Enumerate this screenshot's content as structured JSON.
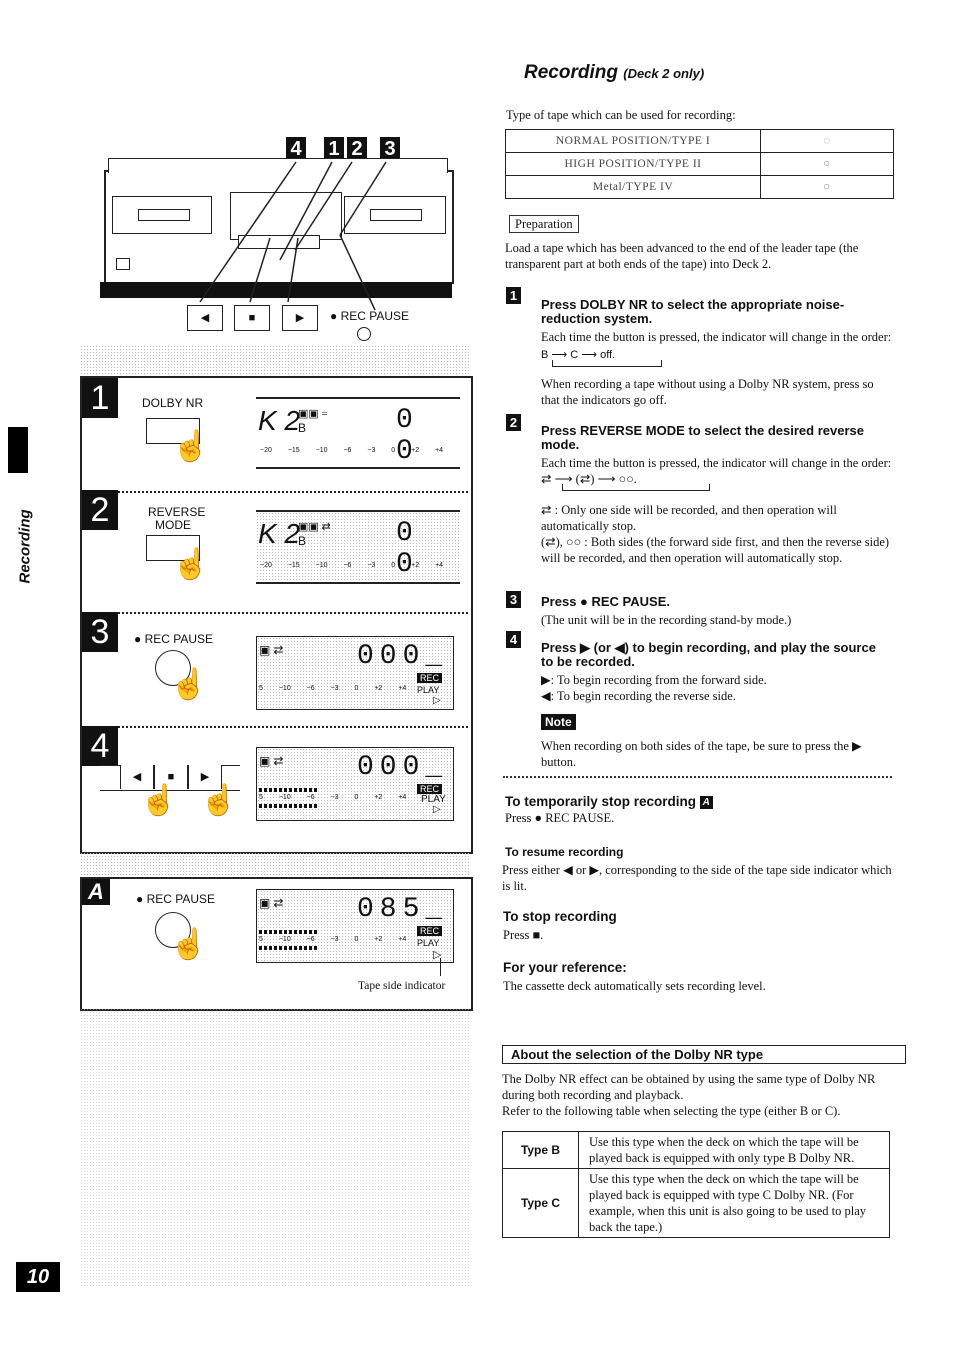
{
  "side_tab": {
    "label": "Recording"
  },
  "page_number": "10",
  "header": {
    "title": "Recording",
    "subtitle": "(Deck 2 only)"
  },
  "tape_types": {
    "intro": "Type of tape which can be used for recording:",
    "rows": [
      {
        "type": "NORMAL POSITION/TYPE I",
        "indicator": "circle-dim"
      },
      {
        "type": "HIGH POSITION/TYPE II",
        "indicator": "circle"
      },
      {
        "type": "Metal/TYPE IV",
        "indicator": "circle"
      }
    ]
  },
  "preparation": {
    "label": "Preparation",
    "text": "Load a tape which has been advanced to the end of the leader tape (the transparent part at both ends of the tape) into Deck 2."
  },
  "steps": [
    {
      "number": "1",
      "heading": "Press DOLBY NR to select the appropriate noise-reduction system.",
      "text": "Each time the button is pressed, the indicator will change in the order:",
      "order": [
        "B",
        "C",
        "off."
      ],
      "extra": "When recording a tape without using a Dolby NR system, press so that the indicators go off."
    },
    {
      "number": "2",
      "heading": "Press REVERSE MODE to select the desired reverse mode.",
      "text": "Each time the button is pressed, the indicator will change in the order:",
      "order": [
        "⇄",
        "(⇄)",
        "○○."
      ],
      "modes": [
        {
          "symbol": "⇄",
          "desc": ": Only one side will be recorded, and then operation will automatically stop."
        },
        {
          "symbol": "(⇄), ○○",
          "desc": ": Both sides (the forward side first, and then the reverse side) will be recorded, and then operation will automatically stop."
        }
      ]
    },
    {
      "number": "3",
      "heading": "Press ● REC PAUSE.",
      "text": "(The unit will be in the recording stand-by mode.)"
    },
    {
      "number": "4",
      "heading": "Press ▶ (or ◀) to begin recording, and play the source to be recorded.",
      "items": [
        "▶: To begin recording from the forward side.",
        "◀: To begin recording the reverse side."
      ]
    }
  ],
  "note": {
    "label": "Note",
    "text": "When recording on both sides of the tape, be sure to press the ▶ button."
  },
  "sections": {
    "pause": {
      "heading": "To temporarily stop recording",
      "tag": "A",
      "text": "Press ● REC PAUSE."
    },
    "resume": {
      "heading": "To resume recording",
      "text": "Press either ◀ or ▶, corresponding to the side of the tape side indicator which is lit."
    },
    "stop": {
      "heading": "To stop recording",
      "text": "Press ■."
    },
    "reference": {
      "heading": "For your reference:",
      "text": "The cassette deck automatically sets recording level."
    }
  },
  "dolby_about": {
    "heading": "About the selection of the Dolby NR type",
    "intro": "The Dolby NR effect can be obtained by using the same type of Dolby NR during both recording and playback.",
    "refer": "Refer to the following table when selecting the type (either B or C).",
    "rows": [
      {
        "type": "Type B",
        "desc": "Use this type when the deck on which the tape will be played back is equipped with only type B Dolby NR."
      },
      {
        "type": "Type C",
        "desc": "Use this type when the deck on which the tape will be played back is equipped with type C Dolby NR. (For example, when this unit is also going to be used to play back the tape.)"
      }
    ]
  },
  "illustration": {
    "deck_tags": [
      "4",
      "1",
      "2",
      "3"
    ],
    "transport_buttons": [
      "◀",
      "■",
      "▶"
    ],
    "rec_pause_label": "● REC PAUSE",
    "panels": [
      {
        "number": "1",
        "button_label": "DOLBY NR",
        "display_prefix": "K 2",
        "display_sub": "B",
        "counter": "0 0",
        "scale": "−20 −15 −10 −6 −3 0 +2 +4"
      },
      {
        "number": "2",
        "button_label": "REVERSE MODE",
        "display_prefix": "K 2",
        "display_sub": "B",
        "counter": "0 0",
        "scale": "−20 −15 −10 −6 −3 0 +2 +4"
      },
      {
        "number": "3",
        "button_label": "● REC PAUSE",
        "counter": "000_",
        "rec": "REC",
        "play": "PLAY",
        "side": "▷",
        "scale": "5 −10 −6 −3 0 +2 +4"
      },
      {
        "number": "4",
        "buttons": [
          "◀",
          "■",
          "▶"
        ],
        "counter": "000_",
        "rec": "REC",
        "play": "PLAY",
        "side": "▷",
        "scale": "5 −10 −6 −3 0 +2 +4"
      }
    ],
    "panel_a": {
      "tag": "A",
      "button_label": "● REC PAUSE",
      "counter": "085_",
      "rec": "REC",
      "play": "PLAY",
      "side": "▷",
      "scale": "5 −10 −6 −3 0 +2 +4",
      "caption": "Tape side indicator"
    }
  }
}
